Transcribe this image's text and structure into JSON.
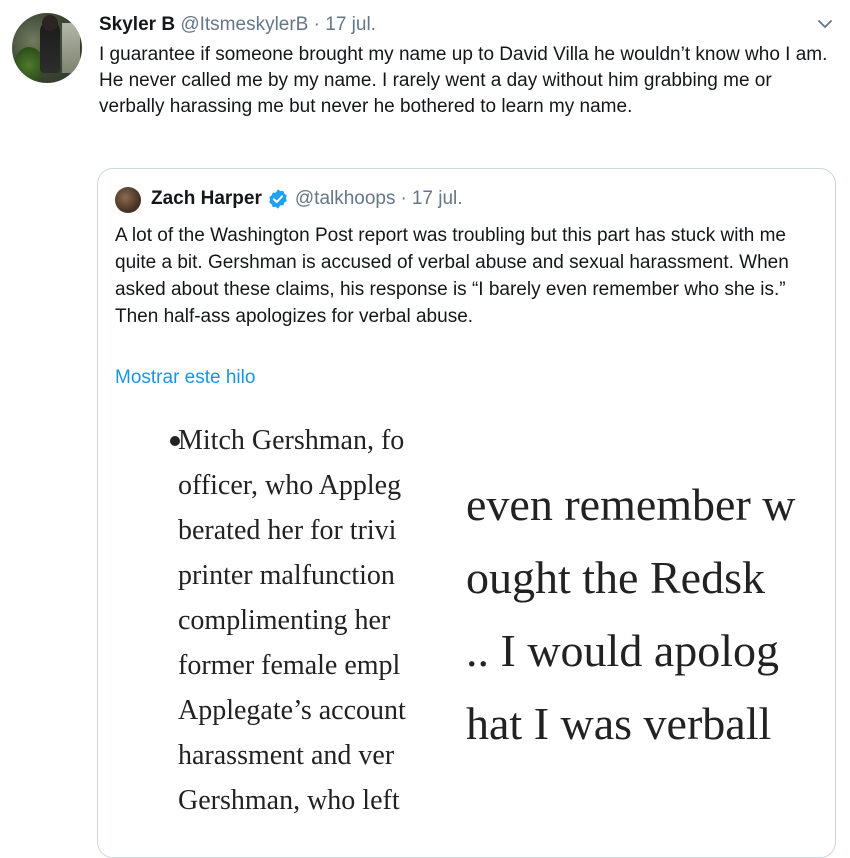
{
  "tweet": {
    "author_name": "Skyler B",
    "handle": "@ItsmeskylerB",
    "separator": "·",
    "date": "17 jul.",
    "text": "I guarantee if someone brought my name up to David Villa he wouldn’t know who I am. He never called me by my name. I rarely went a day without him grabbing me or verbally harassing me but never he bothered to learn my name."
  },
  "quoted": {
    "author_name": "Zach Harper",
    "handle": "@talkhoops",
    "separator": "·",
    "date": "17 jul.",
    "text": "A lot of the Washington Post report was troubling but this part has stuck with me quite a bit. Gershman is accused of verbal abuse and sexual harassment. When asked about these claims, his response is “I barely even remember who she is.” Then half-ass apologizes for verbal abuse.",
    "thread_link": "Mostrar este hilo"
  },
  "media": {
    "left_lines": [
      "Mitch Gershman, fo",
      "officer, who Appleg",
      "berated her for trivi",
      "printer malfunction",
      "complimenting her",
      "former female empl",
      "Applegate’s account",
      "harassment and ver",
      "Gershman, who left"
    ],
    "right_lines": [
      "even remember w",
      "ought the Redsk",
      ".. I would apolog",
      "hat I was verball"
    ]
  },
  "colors": {
    "link": "#1b95e0",
    "secondary_text": "#657786",
    "border": "#ccd6dd",
    "verified": "#1da1f2"
  },
  "icons": {
    "chevron": "chevron-down-icon",
    "verified": "verified-badge-icon"
  }
}
